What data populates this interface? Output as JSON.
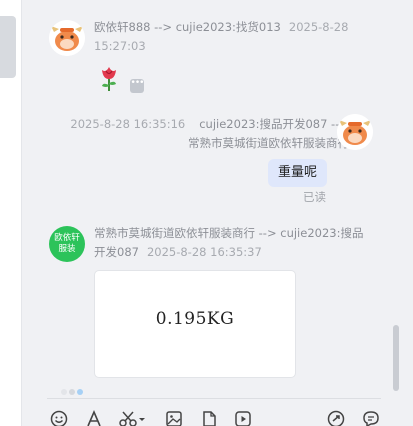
{
  "messages": [
    {
      "direction": "incoming",
      "sender": "欧依轩888 --> cujie2023:找货013",
      "time_line1": "2025-8-28",
      "time_line2": "15:27:03",
      "content_type": "sticker",
      "sticker": "rose-icon"
    },
    {
      "direction": "outgoing",
      "time": "2025-8-28 16:35:16",
      "sender_line1": "cujie2023:搜品开发087 -->",
      "sender_line2": "常熟市莫城街道欧依轩服装商行",
      "text": "重量呢",
      "status": "已读"
    },
    {
      "direction": "incoming",
      "avatar_text_line1": "欧依轩",
      "avatar_text_line2": "服装",
      "sender_line1": "常熟市莫城街道欧依轩服装商行 --> cujie2023:搜品",
      "sender_line2": "开发087",
      "time": "2025-8-28 16:35:37",
      "content_type": "image",
      "image_text": "0.195KG"
    }
  ],
  "toolbar": {
    "buttons": [
      "emoji-icon",
      "font-icon",
      "scissors-icon",
      "image-icon",
      "file-icon",
      "video-icon",
      "history-icon",
      "quick-reply-icon"
    ]
  },
  "colors": {
    "background": "#f0f1f4",
    "outgoing_bubble": "#dfe7fb",
    "green_avatar": "#2cc35a",
    "meta_text": "#8c8f96"
  }
}
